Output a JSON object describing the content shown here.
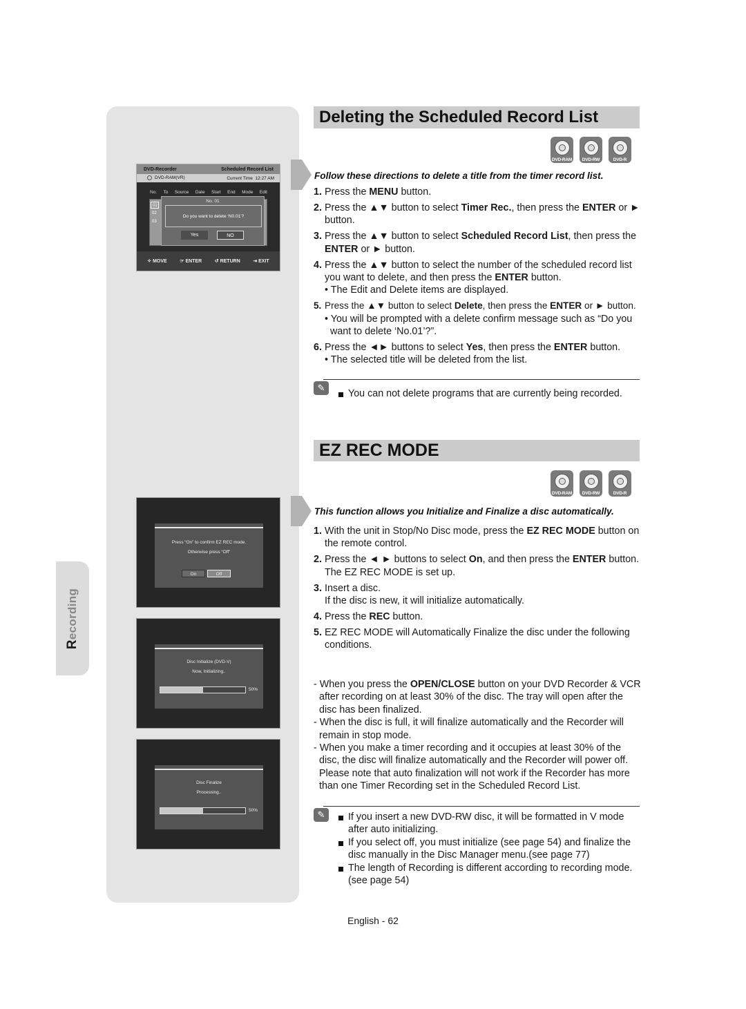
{
  "side_tab": {
    "label": "Recording"
  },
  "section1": {
    "title": "Deleting the Scheduled Record List",
    "discs": [
      "DVD-RAM",
      "DVD-RW",
      "DVD-R"
    ],
    "intro": "Follow these directions to delete a title from the timer record list.",
    "steps": [
      {
        "num": "1.",
        "parts": [
          [
            "Press the ",
            ""
          ],
          [
            "MENU",
            "b"
          ],
          [
            " button.",
            ""
          ]
        ]
      },
      {
        "num": "2.",
        "parts": [
          [
            "Press the ▲▼ button to select ",
            ""
          ],
          [
            "Timer Rec.",
            "b"
          ],
          [
            ", then press the ",
            ""
          ],
          [
            "ENTER",
            "b"
          ],
          [
            " or ► button.",
            ""
          ]
        ]
      },
      {
        "num": "3.",
        "parts": [
          [
            "Press the ▲▼ button to select ",
            ""
          ],
          [
            "Scheduled Record List",
            "b"
          ],
          [
            ", then press the ",
            ""
          ],
          [
            "ENTER",
            "b"
          ],
          [
            " or ► button.",
            ""
          ]
        ]
      },
      {
        "num": "4.",
        "parts": [
          [
            "Press the ▲▼ button to select the number of the scheduled record list you want to delete, and then press the ",
            ""
          ],
          [
            "ENTER",
            "b"
          ],
          [
            " button.",
            ""
          ]
        ],
        "subs": [
          "• The Edit and Delete items are displayed."
        ]
      },
      {
        "num": "5.",
        "parts": [
          [
            "Press the ▲▼ button to select ",
            ""
          ],
          [
            "Delete",
            "b"
          ],
          [
            ", then press the ",
            ""
          ],
          [
            "ENTER",
            "b"
          ],
          [
            " or ► button.",
            ""
          ]
        ],
        "subs": [
          "• You will be prompted with a delete confirm message such as “Do you want to delete ‘No.01’?”."
        ],
        "tight": true
      },
      {
        "num": "6.",
        "parts": [
          [
            "Press the ◄► buttons to select ",
            ""
          ],
          [
            "Yes",
            "b"
          ],
          [
            ", then press the ",
            ""
          ],
          [
            "ENTER",
            "b"
          ],
          [
            " button.",
            ""
          ]
        ],
        "subs": [
          "• The selected title will be deleted from the list."
        ]
      }
    ],
    "notes": [
      "You can not delete programs that are currently being recorded."
    ]
  },
  "osd_delete": {
    "header_left": "DVD-Recorder",
    "header_right": "Scheduled Record List",
    "disc": "DVD-RAM(VR)",
    "time_label": "Current Time",
    "time": "12:27 AM",
    "columns": [
      "No.",
      "To",
      "Source",
      "Date",
      "Start",
      "End",
      "Mode",
      "Edit"
    ],
    "rows": [
      "01",
      "02",
      "03"
    ],
    "popup_title": "No. 01",
    "popup_message": "Do you want to delete ‘N0.01’?",
    "yes": "Yes",
    "no": "NO",
    "footer": [
      "MOVE",
      "ENTER",
      "RETURN",
      "EXIT"
    ]
  },
  "section2": {
    "title": "EZ REC MODE",
    "discs": [
      "DVD-RAM",
      "DVD-RW",
      "DVD-R"
    ],
    "intro": "This function allows you Initialize and Finalize a  disc automatically.",
    "steps": [
      {
        "num": "1.",
        "parts": [
          [
            "With the unit in Stop/No Disc mode, press the ",
            ""
          ],
          [
            "EZ REC MODE",
            "b"
          ],
          [
            " button on the remote control.",
            ""
          ]
        ]
      },
      {
        "num": "2.",
        "parts": [
          [
            "Press the ◄ ► buttons to select ",
            ""
          ],
          [
            "On",
            "b"
          ],
          [
            ", and then press the ",
            ""
          ],
          [
            "ENTER",
            "b"
          ],
          [
            " button.",
            ""
          ]
        ],
        "plain": [
          "The EZ REC MODE is set up."
        ]
      },
      {
        "num": "3.",
        "parts": [
          [
            "Insert a disc.",
            ""
          ]
        ],
        "plain": [
          "If the disc is new, it will initialize automatically."
        ]
      },
      {
        "num": "4.",
        "parts": [
          [
            "Press the ",
            ""
          ],
          [
            "REC",
            "b"
          ],
          [
            " button.",
            ""
          ]
        ]
      },
      {
        "num": "5.",
        "parts": [
          [
            "EZ REC MODE will Automatically Finalize the disc under the following conditions.",
            ""
          ]
        ]
      }
    ],
    "conditions": [
      [
        [
          "- When you press the ",
          ""
        ],
        [
          "OPEN/CLOSE",
          "b"
        ],
        [
          " button on your DVD Recorder & VCR after recording on at least 30% of the disc.  The tray will open after the disc has been finalized.",
          ""
        ]
      ],
      [
        [
          "- When the disc is full, it will finalize automatically and the Recorder will remain in stop mode.",
          ""
        ]
      ],
      [
        [
          "- When you make a timer recording and it occupies at least 30% of the disc, the disc will finalize automatically and the Recorder will power off. Please note that auto finalization will not work if the Recorder has more than one Timer Recording set in the Scheduled Record List.",
          ""
        ]
      ]
    ],
    "notes": [
      "If you insert a new DVD-RW disc, it will be formatted in V mode after auto initializing.",
      "If you select off, you must initialize (see page 54) and finalize the disc manually in the Disc Manager menu.(see page 77)",
      "The length of Recording is different according to recording mode. (see page 54)"
    ]
  },
  "osd_ezrec": {
    "line1": "Press “On” to confirm EZ REC mode.",
    "line2": "Otherwise press “Off”",
    "on": "On",
    "off": "Off"
  },
  "osd_init": {
    "line1": "Disc Initialize (DVD-V)",
    "line2": "Now, Initializing..",
    "progress_pct": 50,
    "progress_label": "50%"
  },
  "osd_finalize": {
    "line1": "Disc Finalize",
    "line2": "Processing..",
    "progress_pct": 50,
    "progress_label": "50%"
  },
  "footer": {
    "page": "English - 62"
  }
}
